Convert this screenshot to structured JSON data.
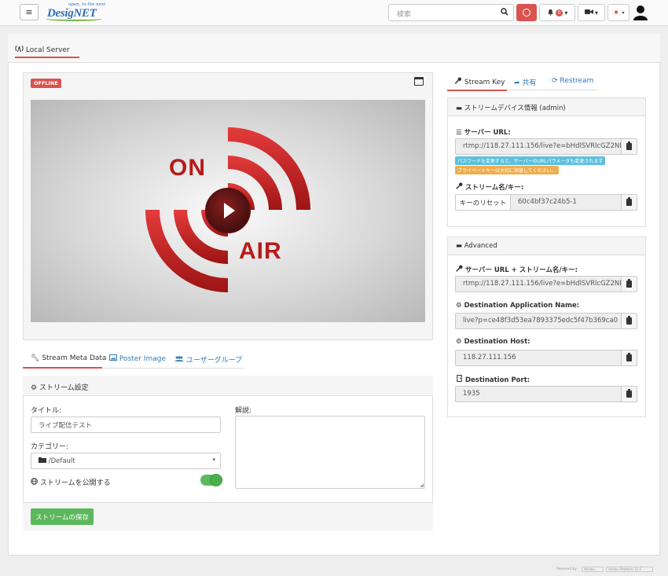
{
  "header": {
    "logo_tagline": "open, to the next",
    "logo_name": "DesigNET",
    "search_placeholder": "検索",
    "notification_count": "0"
  },
  "page_tab": {
    "label": "Local Server"
  },
  "player": {
    "status_badge": "OFFLINE",
    "overlay_text_top": "ON",
    "overlay_text_bottom": "AIR"
  },
  "meta_tabs": [
    {
      "label": "Stream Meta Data"
    },
    {
      "label": "Poster Image"
    },
    {
      "label": "ユーザーグループ"
    }
  ],
  "stream_settings": {
    "heading": "ストリーム設定",
    "title_label": "タイトル:",
    "title_value": "ライブ配信テスト",
    "category_label": "カテゴリー:",
    "category_value": "/Default",
    "public_label": "ストリームを公開する",
    "description_label": "解説:",
    "save_button": "ストリームの保存"
  },
  "right_tabs": [
    {
      "label": "Stream Key"
    },
    {
      "label": "共有"
    },
    {
      "label": "Restream"
    }
  ],
  "device_info": {
    "heading": "ストリームデバイス情報 (admin)",
    "server_url_label": "サーバー URL:",
    "server_url_value": "rtmp://118.27.111.156/live?e=bHdlSVRlcGZ2NFV",
    "notice_1": "パスワードを変更すると、サーバーのURLパラメータも変更されます",
    "notice_2": "プライベートキーは大切に保管してください。",
    "stream_key_label": "ストリーム名/キー:",
    "reset_key_button": "キーのリセット",
    "stream_key_value": "60c4bf37c24b5-1"
  },
  "advanced": {
    "heading": "Advanced",
    "full_url_label": "サーバー URL + ストリーム名/キー:",
    "full_url_value": "rtmp://118.27.111.156/live?e=bHdlSVRlcGZ2NFV",
    "app_name_label": "Destination Application Name:",
    "app_name_value": "live?p=ce48f3d53ea7893375edc5f47b369ca0",
    "host_label": "Destination Host:",
    "host_value": "118.27.111.156",
    "port_label": "Destination Port:",
    "port_value": "1935"
  },
  "footer": {
    "powered_by": "Powered by",
    "badge_1": "AVideo",
    "badge_2": "AVideo Platform 11.5"
  },
  "colors": {
    "accent_red": "#d9534f",
    "link_blue": "#337ab7",
    "success_green": "#5cb85c",
    "info_blue": "#5bc0de",
    "warning_orange": "#f0ad4e"
  }
}
